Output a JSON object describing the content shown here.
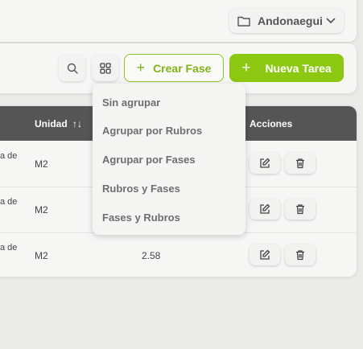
{
  "header": {
    "project_name": "Andonaegui"
  },
  "toolbar": {
    "crear_fase_label": "Crear Fase",
    "nueva_tarea_label": "Nueva Tarea",
    "plus_symbol": "+",
    "accent_color": "#8cc811"
  },
  "group_menu": {
    "items": [
      {
        "label": "Sin agrupar"
      },
      {
        "label": "Agrupar por Rubros"
      },
      {
        "label": "Agrupar por Fases"
      },
      {
        "label": "Rubros y Fases"
      },
      {
        "label": "Fases y Rubros"
      }
    ]
  },
  "table": {
    "columns": {
      "unidad": "Unidad",
      "sort_symbol": "↑↓",
      "acciones": "Acciones"
    },
    "rows": [
      {
        "desc_fragment": "a de",
        "unit": "M2",
        "value": ""
      },
      {
        "desc_fragment": "a de",
        "unit": "M2",
        "value": ""
      },
      {
        "desc_fragment": "a de",
        "unit": "M2",
        "value": "2.58"
      }
    ]
  },
  "icons": {
    "project": "folder-icon",
    "project_toggle": "chevron-down-icon",
    "search": "search-icon",
    "group": "grid-icon",
    "edit": "edit-icon",
    "delete": "trash-icon"
  }
}
